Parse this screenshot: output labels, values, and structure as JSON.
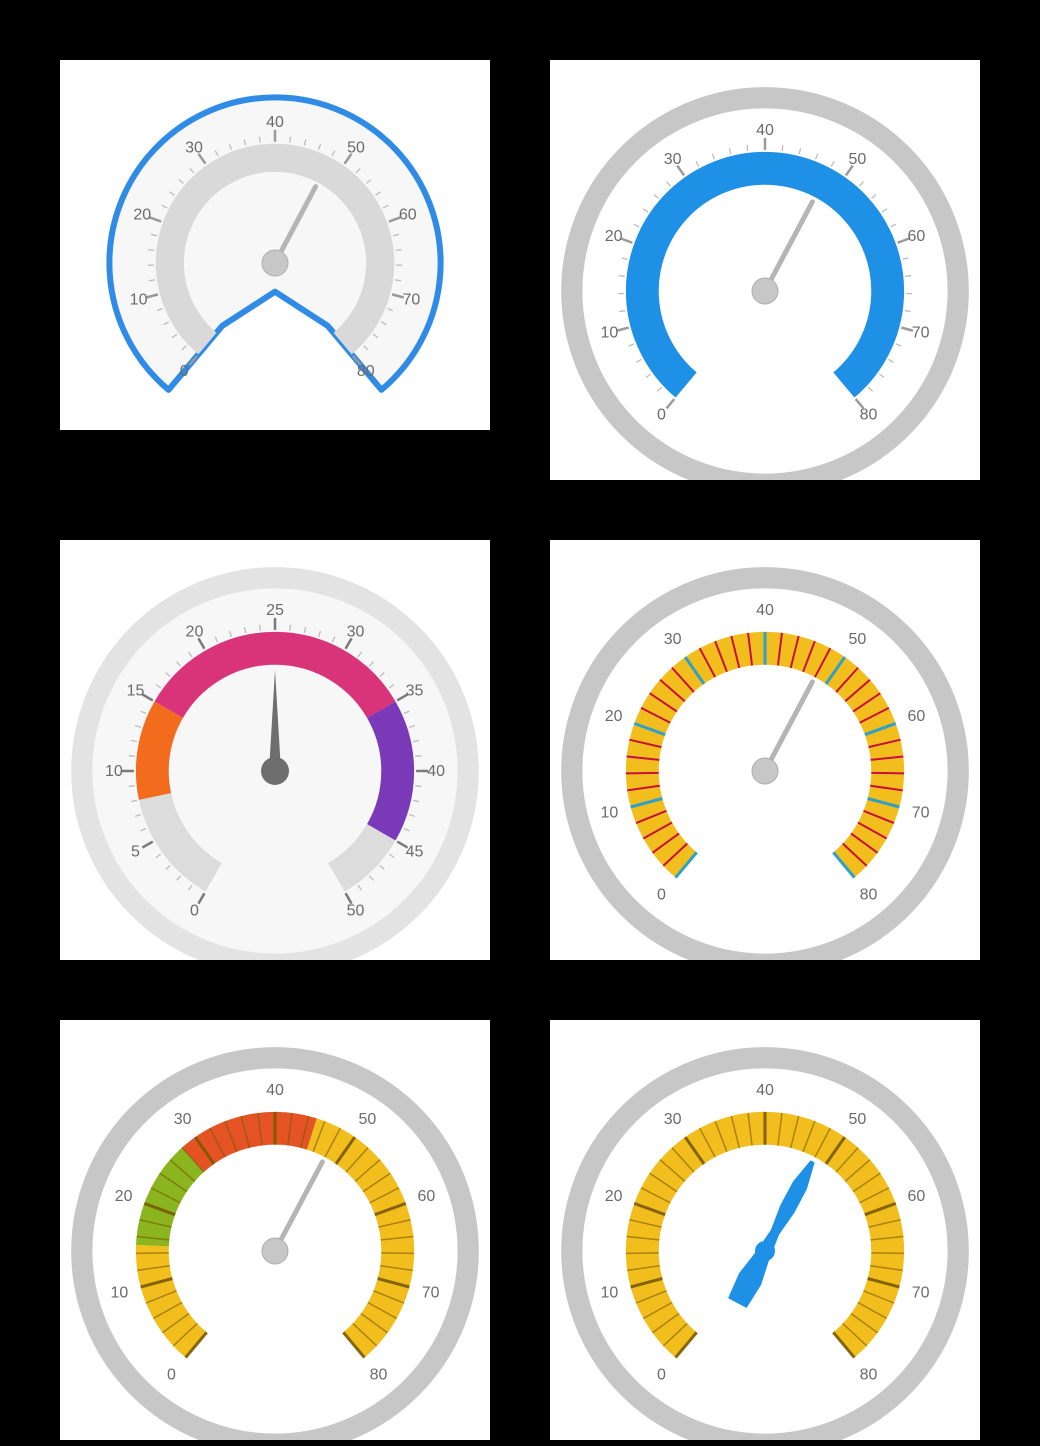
{
  "chart_data": [
    {
      "type": "gauge",
      "id": "g1",
      "min": 0,
      "max": 80,
      "value": 48,
      "tick_labels": [
        0,
        10,
        20,
        30,
        40,
        50,
        60,
        70,
        80
      ],
      "start_angle_deg": 230,
      "end_angle_deg": -50,
      "outline_color": "#2F8BE6",
      "scale_band_color": "#D9D9D9",
      "needle_color": "#B5B5B5",
      "hub_color": "#C7C7C7",
      "face_color": "#F7F7F7"
    },
    {
      "type": "gauge",
      "id": "g2",
      "min": 0,
      "max": 80,
      "value": 48,
      "tick_labels": [
        0,
        10,
        20,
        30,
        40,
        50,
        60,
        70,
        80
      ],
      "start_angle_deg": 230,
      "end_angle_deg": -50,
      "outer_ring_color": "#C7C7C7",
      "scale_band_color": "#1E90E6",
      "needle_color": "#B5B5B5",
      "hub_color": "#C7C7C7",
      "face_color": "#FFFFFF"
    },
    {
      "type": "gauge",
      "id": "g3",
      "min": 0,
      "max": 50,
      "value": 25,
      "tick_labels": [
        0,
        5,
        10,
        15,
        20,
        25,
        30,
        35,
        40,
        45,
        50
      ],
      "start_angle_deg": 240,
      "end_angle_deg": -60,
      "outer_ring_color": "#E3E3E3",
      "segments": [
        {
          "from": 0,
          "to": 8,
          "color": "#DCDCDC"
        },
        {
          "from": 8,
          "to": 15,
          "color": "#F36B1C"
        },
        {
          "from": 15,
          "to": 35,
          "color": "#D9337A"
        },
        {
          "from": 35,
          "to": 45,
          "color": "#7A3AB8"
        },
        {
          "from": 45,
          "to": 50,
          "color": "#DCDCDC"
        }
      ],
      "needle_color": "#6E6E6E",
      "hub_color": "#6E6E6E",
      "face_color": "#F7F7F7"
    },
    {
      "type": "gauge",
      "id": "g4",
      "min": 0,
      "max": 80,
      "value": 48,
      "tick_labels": [
        0,
        10,
        20,
        30,
        40,
        50,
        60,
        70,
        80
      ],
      "start_angle_deg": 230,
      "end_angle_deg": -50,
      "outer_ring_color": "#C7C7C7",
      "scale_band_color": "#F1BE1E",
      "minor_tick_color": "#C8103E",
      "major_tick_color": "#2FA0C9",
      "needle_color": "#B5B5B5",
      "hub_color": "#C7C7C7",
      "face_color": "#FFFFFF"
    },
    {
      "type": "gauge",
      "id": "g5",
      "min": 0,
      "max": 80,
      "value": 48,
      "tick_labels": [
        0,
        10,
        20,
        30,
        40,
        50,
        60,
        70,
        80
      ],
      "start_angle_deg": 230,
      "end_angle_deg": -50,
      "outer_ring_color": "#C7C7C7",
      "segments": [
        {
          "from": 0,
          "to": 15,
          "color": "#F1BE1E"
        },
        {
          "from": 15,
          "to": 28,
          "color": "#8BB51E"
        },
        {
          "from": 28,
          "to": 45,
          "color": "#E55325"
        },
        {
          "from": 45,
          "to": 80,
          "color": "#F1BE1E"
        }
      ],
      "needle_color": "#B5B5B5",
      "hub_color": "#C7C7C7",
      "face_color": "#FFFFFF"
    },
    {
      "type": "gauge",
      "id": "g6",
      "min": 0,
      "max": 80,
      "value": 48,
      "tick_labels": [
        0,
        10,
        20,
        30,
        40,
        50,
        60,
        70,
        80
      ],
      "start_angle_deg": 230,
      "end_angle_deg": -50,
      "outer_ring_color": "#C7C7C7",
      "scale_band_color": "#F1BE1E",
      "needle_color": "#1E90E6",
      "needle_style": "rough",
      "hub_color": "#1E90E6",
      "face_color": "#FFFFFF"
    }
  ],
  "layout_notes": "2x3 grid of radial gauge examples on black background. Card 1 is shorter with a custom blue outline following the gauge shape. Cards 2-6 are full square cards with a thick light-grey outer ring."
}
